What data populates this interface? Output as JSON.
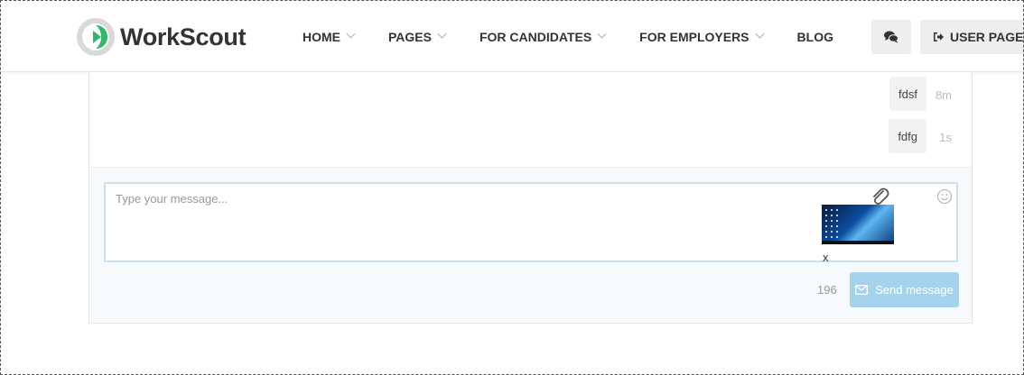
{
  "header": {
    "logo_text": "WorkScout",
    "nav": [
      {
        "label": "HOME",
        "has_dropdown": true
      },
      {
        "label": "PAGES",
        "has_dropdown": true
      },
      {
        "label": "FOR CANDIDATES",
        "has_dropdown": true
      },
      {
        "label": "FOR EMPLOYERS",
        "has_dropdown": true
      },
      {
        "label": "BLOG",
        "has_dropdown": false
      }
    ],
    "chat_icon": "chat-bubbles-icon",
    "user_button_label": "USER PAGE",
    "user_icon": "sign-in-icon",
    "brand_colors": {
      "green": "#34b66f",
      "gray": "#d9d9d9"
    }
  },
  "messages": [
    {
      "text": "fdsf",
      "time": "8m"
    },
    {
      "text": "fdfg",
      "time": "1s"
    }
  ],
  "composer": {
    "placeholder": "Type your message...",
    "attach_icon": "paperclip-icon",
    "emoji_icon": "smiley-icon",
    "attachment_remove_label": "x",
    "char_counter": "196",
    "send_label": "Send message",
    "send_icon": "envelope-icon",
    "send_color": "#a5d3ee"
  }
}
